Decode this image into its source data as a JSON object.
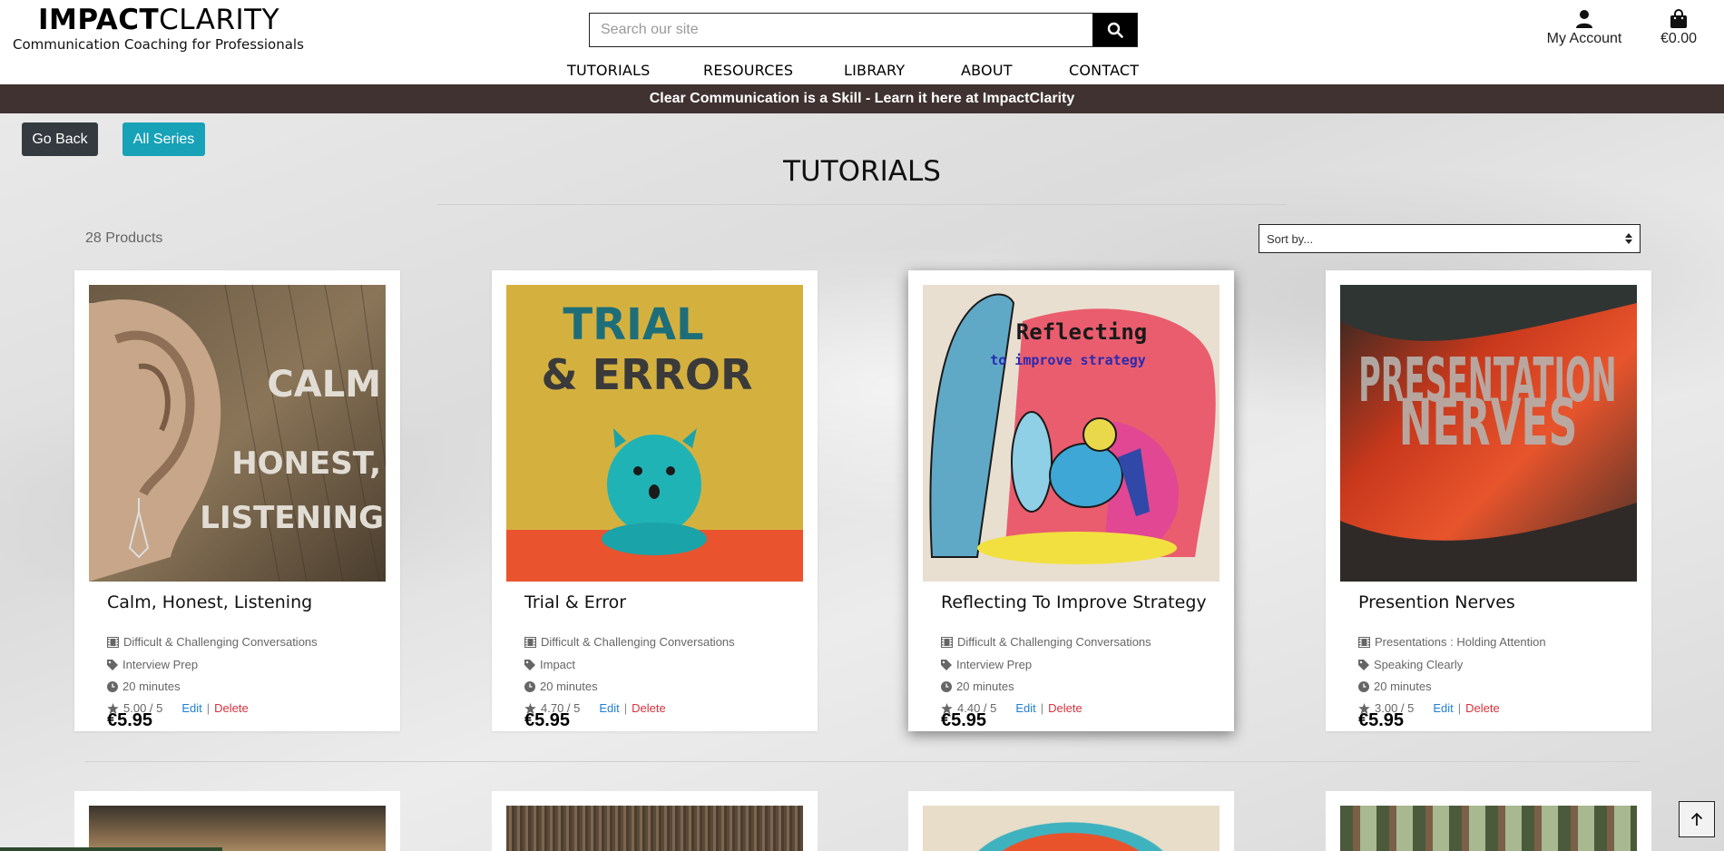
{
  "header": {
    "logo_bold": "IMPACT",
    "logo_light": "CLARITY",
    "tagline": "Communication Coaching for Professionals",
    "search_placeholder": "Search our site",
    "account_label": "My Account",
    "bag_total": "€0.00"
  },
  "nav": [
    "TUTORIALS",
    "RESOURCES",
    "LIBRARY",
    "ABOUT",
    "CONTACT"
  ],
  "banner": "Clear Communication is a Skill - Learn it here at ImpactClarity",
  "buttons": {
    "back": "Go Back",
    "series": "All Series"
  },
  "page_title": "TUTORIALS",
  "product_count": "28 Products",
  "sort": {
    "selected": "Sort by..."
  },
  "products": [
    {
      "title": "Calm, Honest, Listening",
      "category": "Difficult & Challenging Conversations",
      "tag": "Interview Prep",
      "duration": "20 minutes",
      "rating": "5.00 / 5",
      "edit": "Edit",
      "delete": "Delete",
      "price": "€5.95",
      "image_text": [
        "CALM",
        "HONEST,",
        "LISTENING"
      ]
    },
    {
      "title": "Trial & Error",
      "category": "Difficult & Challenging Conversations",
      "tag": "Impact",
      "duration": "20 minutes",
      "rating": "4.70 / 5",
      "edit": "Edit",
      "delete": "Delete",
      "price": "€5.95",
      "image_text": [
        "TRIAL",
        "& ERROR"
      ]
    },
    {
      "title": "Reflecting To Improve Strategy",
      "category": "Difficult & Challenging Conversations",
      "tag": "Interview Prep",
      "duration": "20 minutes",
      "rating": "4.40 / 5",
      "edit": "Edit",
      "delete": "Delete",
      "price": "€5.95",
      "image_text": [
        "Reflecting",
        "to improve strategy"
      ]
    },
    {
      "title": "Presention Nerves",
      "category": "Presentations : Holding Attention",
      "tag": "Speaking Clearly",
      "duration": "20 minutes",
      "rating": "3.00 / 5",
      "edit": "Edit",
      "delete": "Delete",
      "price": "€5.95",
      "image_text": [
        "PRESENTATION",
        "NERVES"
      ]
    }
  ],
  "colors": {
    "banner_bg": "#3f3230",
    "back_button": "#343a40",
    "series_button": "#17a2b8",
    "edit_link": "#1e7fd6",
    "delete_link": "#d9313c"
  }
}
